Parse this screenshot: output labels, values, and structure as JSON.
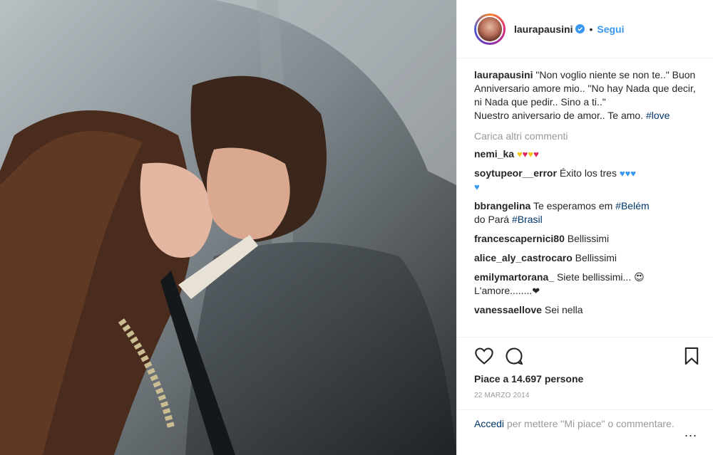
{
  "post": {
    "username": "laurapausini",
    "follow_label": "Segui",
    "separator": "•"
  },
  "caption": {
    "username": "laurapausini",
    "text": "\"Non voglio niente se non te..\" Buon Anniversario amore mio.. \"No hay Nada que decir, ni Nada que pedir.. Sino a ti..\"",
    "line2": "Nuestro aniversario de amor.. Te amo.",
    "hashtag": "#love"
  },
  "load_more": "Carica altri commenti",
  "comments": [
    {
      "user": "nemi_ka",
      "text": "",
      "emoji": [
        "yellow-heart",
        "red-heart",
        "yellow-heart",
        "red-heart"
      ]
    },
    {
      "user": "soytupeor__error",
      "text": "Éxito los tres",
      "emoji": [
        "blue-heart",
        "blue-heart",
        "blue-heart",
        "blue-heart"
      ]
    },
    {
      "user": "bbrangelina",
      "text": "Te esperamos em",
      "tag1": "#Belém",
      "text2": "do Pará",
      "tag2": "#Brasil"
    },
    {
      "user": "francescapernici80",
      "text": "Bellissimi"
    },
    {
      "user": "alice_aly_castrocaro",
      "text": "Bellissimi"
    },
    {
      "user": "emilymartorana_",
      "text": "Siete bellissimi...",
      "emoji_face": "😍",
      "text2": "L'amore........",
      "heart": "❤"
    },
    {
      "user": "vanessaellove",
      "text": "Sei nella"
    }
  ],
  "likes": "Piace a 14.697 persone",
  "date": "22 MARZO 2014",
  "login": {
    "link": "Accedi",
    "rest": "per mettere \"Mi piace\" o commentare."
  },
  "more": "...",
  "icons": {
    "like": "heart-outline-icon",
    "comment": "comment-bubble-icon",
    "save": "bookmark-icon",
    "verified": "verified-badge-icon"
  },
  "colors": {
    "link_blue": "#3897f0",
    "hashtag": "#003569",
    "muted": "#999999"
  }
}
